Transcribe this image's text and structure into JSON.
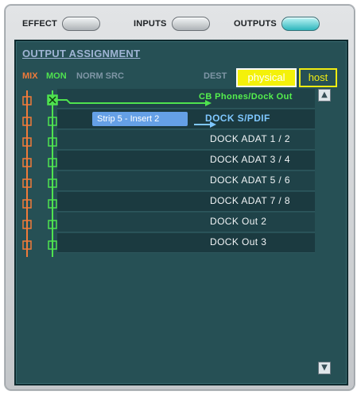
{
  "topbar": {
    "tabs": [
      {
        "label": "EFFECT",
        "active": false
      },
      {
        "label": "INPUTS",
        "active": false
      },
      {
        "label": "OUTPUTS",
        "active": true
      }
    ]
  },
  "panel": {
    "title": "OUTPUT ASSIGNMENT",
    "headers": {
      "mix": "MIX",
      "mon": "MON",
      "norm_src": "NORM SRC",
      "dest": "DEST"
    },
    "dest_buttons": {
      "physical": "physical",
      "host": "host"
    },
    "rows": [
      {
        "dest": "CB Phones/Dock Out",
        "source": ""
      },
      {
        "dest": "DOCK S/PDIF",
        "source": "Strip 5 - Insert 2"
      },
      {
        "dest": "DOCK ADAT 1 / 2",
        "source": ""
      },
      {
        "dest": "DOCK ADAT 3 / 4",
        "source": ""
      },
      {
        "dest": "DOCK ADAT 5 / 6",
        "source": ""
      },
      {
        "dest": "DOCK ADAT 7 / 8",
        "source": ""
      },
      {
        "dest": "DOCK Out 2",
        "source": ""
      },
      {
        "dest": "DOCK Out 3",
        "source": ""
      }
    ]
  },
  "icons": {
    "scroll_up": "arrow-up-icon",
    "scroll_down": "arrow-down-icon",
    "mon_active": "x-node-icon"
  },
  "colors": {
    "mix": "#f07a3a",
    "mon": "#4fe34f",
    "physical_bg": "#f4f10a",
    "panel_bg": "#265055",
    "spdif_text": "#7fc7ff",
    "source_box": "#65a0e6"
  }
}
